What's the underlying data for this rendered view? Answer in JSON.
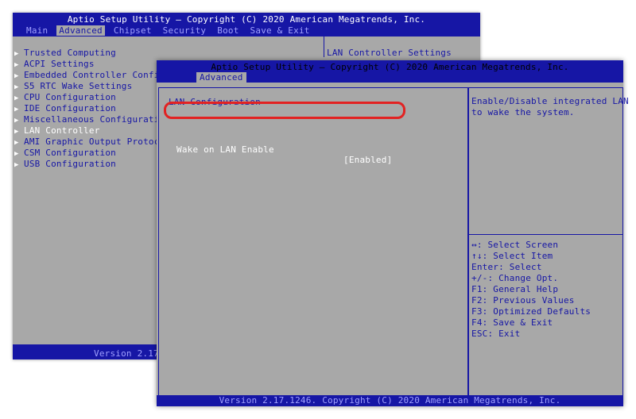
{
  "background_screen": {
    "title": "Aptio Setup Utility – Copyright (C) 2020 American Megatrends, Inc.",
    "menu": [
      "Main",
      "Advanced",
      "Chipset",
      "Security",
      "Boot",
      "Save & Exit"
    ],
    "active_menu": "Advanced",
    "items": [
      "Trusted Computing",
      "ACPI Settings",
      "Embedded Controller Configura",
      "S5 RTC Wake Settings",
      "CPU Configuration",
      "IDE Configuration",
      "Miscellaneous Configuration",
      "LAN Controller",
      "AMI Graphic Output Protocol P",
      "CSM Configuration",
      "USB Configuration"
    ],
    "selected_item": "LAN Controller",
    "right_panel_text": "LAN Controller Settings",
    "version": "Version 2.17."
  },
  "foreground_screen": {
    "title": "Aptio Setup Utility – Copyright (C) 2020 American Megatrends, Inc.",
    "tab": "Advanced",
    "section_title": "LAN Configuration",
    "option": {
      "label": "Wake on LAN Enable",
      "value": "[Enabled]"
    },
    "help_text": "Enable/Disable integrated LAN\nto wake the system.",
    "keys": [
      "↔: Select Screen",
      "↑↓: Select Item",
      "Enter: Select",
      "+/-: Change Opt.",
      "F1: General Help",
      "F2: Previous Values",
      "F3: Optimized Defaults",
      "F4: Save & Exit",
      "ESC: Exit"
    ],
    "footer": "Version 2.17.1246. Copyright (C) 2020 American Megatrends, Inc."
  },
  "colors": {
    "bios_blue": "#1616a5",
    "bios_gray": "#a8a8a8",
    "highlight_red": "#e22222"
  }
}
